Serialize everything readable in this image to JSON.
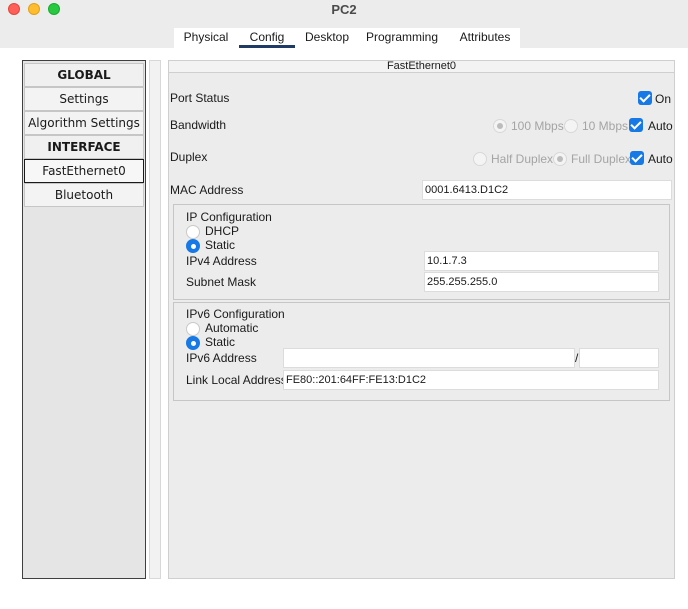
{
  "window": {
    "title": "PC2"
  },
  "tabs": [
    {
      "label": "Physical"
    },
    {
      "label": "Config"
    },
    {
      "label": "Desktop"
    },
    {
      "label": "Programming"
    },
    {
      "label": "Attributes"
    }
  ],
  "active_tab": "Config",
  "sidebar": {
    "global_header": "GLOBAL",
    "settings": "Settings",
    "algorithm_settings": "Algorithm Settings",
    "interface_header": "INTERFACE",
    "fastethernet": "FastEthernet0",
    "bluetooth": "Bluetooth",
    "selected": "FastEthernet0"
  },
  "panel": {
    "title": "FastEthernet0",
    "port_status": {
      "label": "Port Status",
      "on_label": "On",
      "checked": true
    },
    "bandwidth": {
      "label": "Bandwidth",
      "opt1": "100 Mbps",
      "opt2": "10 Mbps",
      "auto_label": "Auto",
      "selected": "100 Mbps",
      "auto": true
    },
    "duplex": {
      "label": "Duplex",
      "opt1": "Half Duplex",
      "opt2": "Full Duplex",
      "auto_label": "Auto",
      "selected": "Full Duplex",
      "auto": true
    },
    "mac": {
      "label": "MAC Address",
      "value": "0001.6413.D1C2"
    },
    "ipv4_group": {
      "title": "IP Configuration",
      "dhcp_label": "DHCP",
      "static_label": "Static",
      "mode": "Static",
      "address_label": "IPv4 Address",
      "address_value": "10.1.7.3",
      "mask_label": "Subnet Mask",
      "mask_value": "255.255.255.0"
    },
    "ipv6_group": {
      "title": "IPv6 Configuration",
      "automatic_label": "Automatic",
      "static_label": "Static",
      "mode": "Static",
      "address_label": "IPv6 Address",
      "address_value": "",
      "slash": "/",
      "prefix_value": "",
      "link_local_label": "Link Local Address:",
      "link_local_value": "FE80::201:64FF:FE13:D1C2"
    }
  },
  "colors": {
    "accent": "#1679e6",
    "tab_underline": "#1f3b64",
    "traffic_red": "#fe5f57",
    "traffic_yellow": "#febc2e",
    "traffic_green": "#28c840"
  }
}
